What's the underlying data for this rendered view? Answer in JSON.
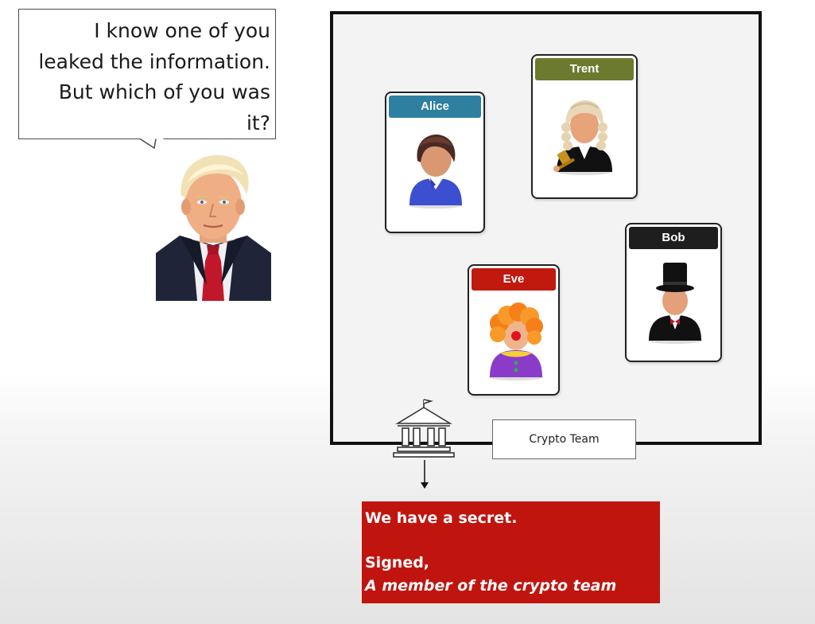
{
  "speech_bubble": {
    "lines": [
      "I know one of you",
      "leaked the information.",
      "But which of you was",
      "it?"
    ]
  },
  "team": {
    "label": "Crypto Team",
    "members": [
      {
        "name": "Alice",
        "header_color": "#2e7fa0",
        "icon": "woman-avatar-icon"
      },
      {
        "name": "Trent",
        "header_color": "#6b7a2e",
        "icon": "judge-avatar-icon"
      },
      {
        "name": "Bob",
        "header_color": "#1e1e1e",
        "icon": "top-hat-gentleman-icon"
      },
      {
        "name": "Eve",
        "header_color": "#c2190f",
        "icon": "clown-avatar-icon"
      }
    ]
  },
  "message": {
    "line1": "We have a secret.",
    "line2": "Signed,",
    "line3": "A member of the crypto team",
    "background": "#c0150f"
  },
  "icons": {
    "bank": "bank-building-icon",
    "arrow": "down-arrow-icon",
    "portrait": "man-in-suit-portrait"
  }
}
